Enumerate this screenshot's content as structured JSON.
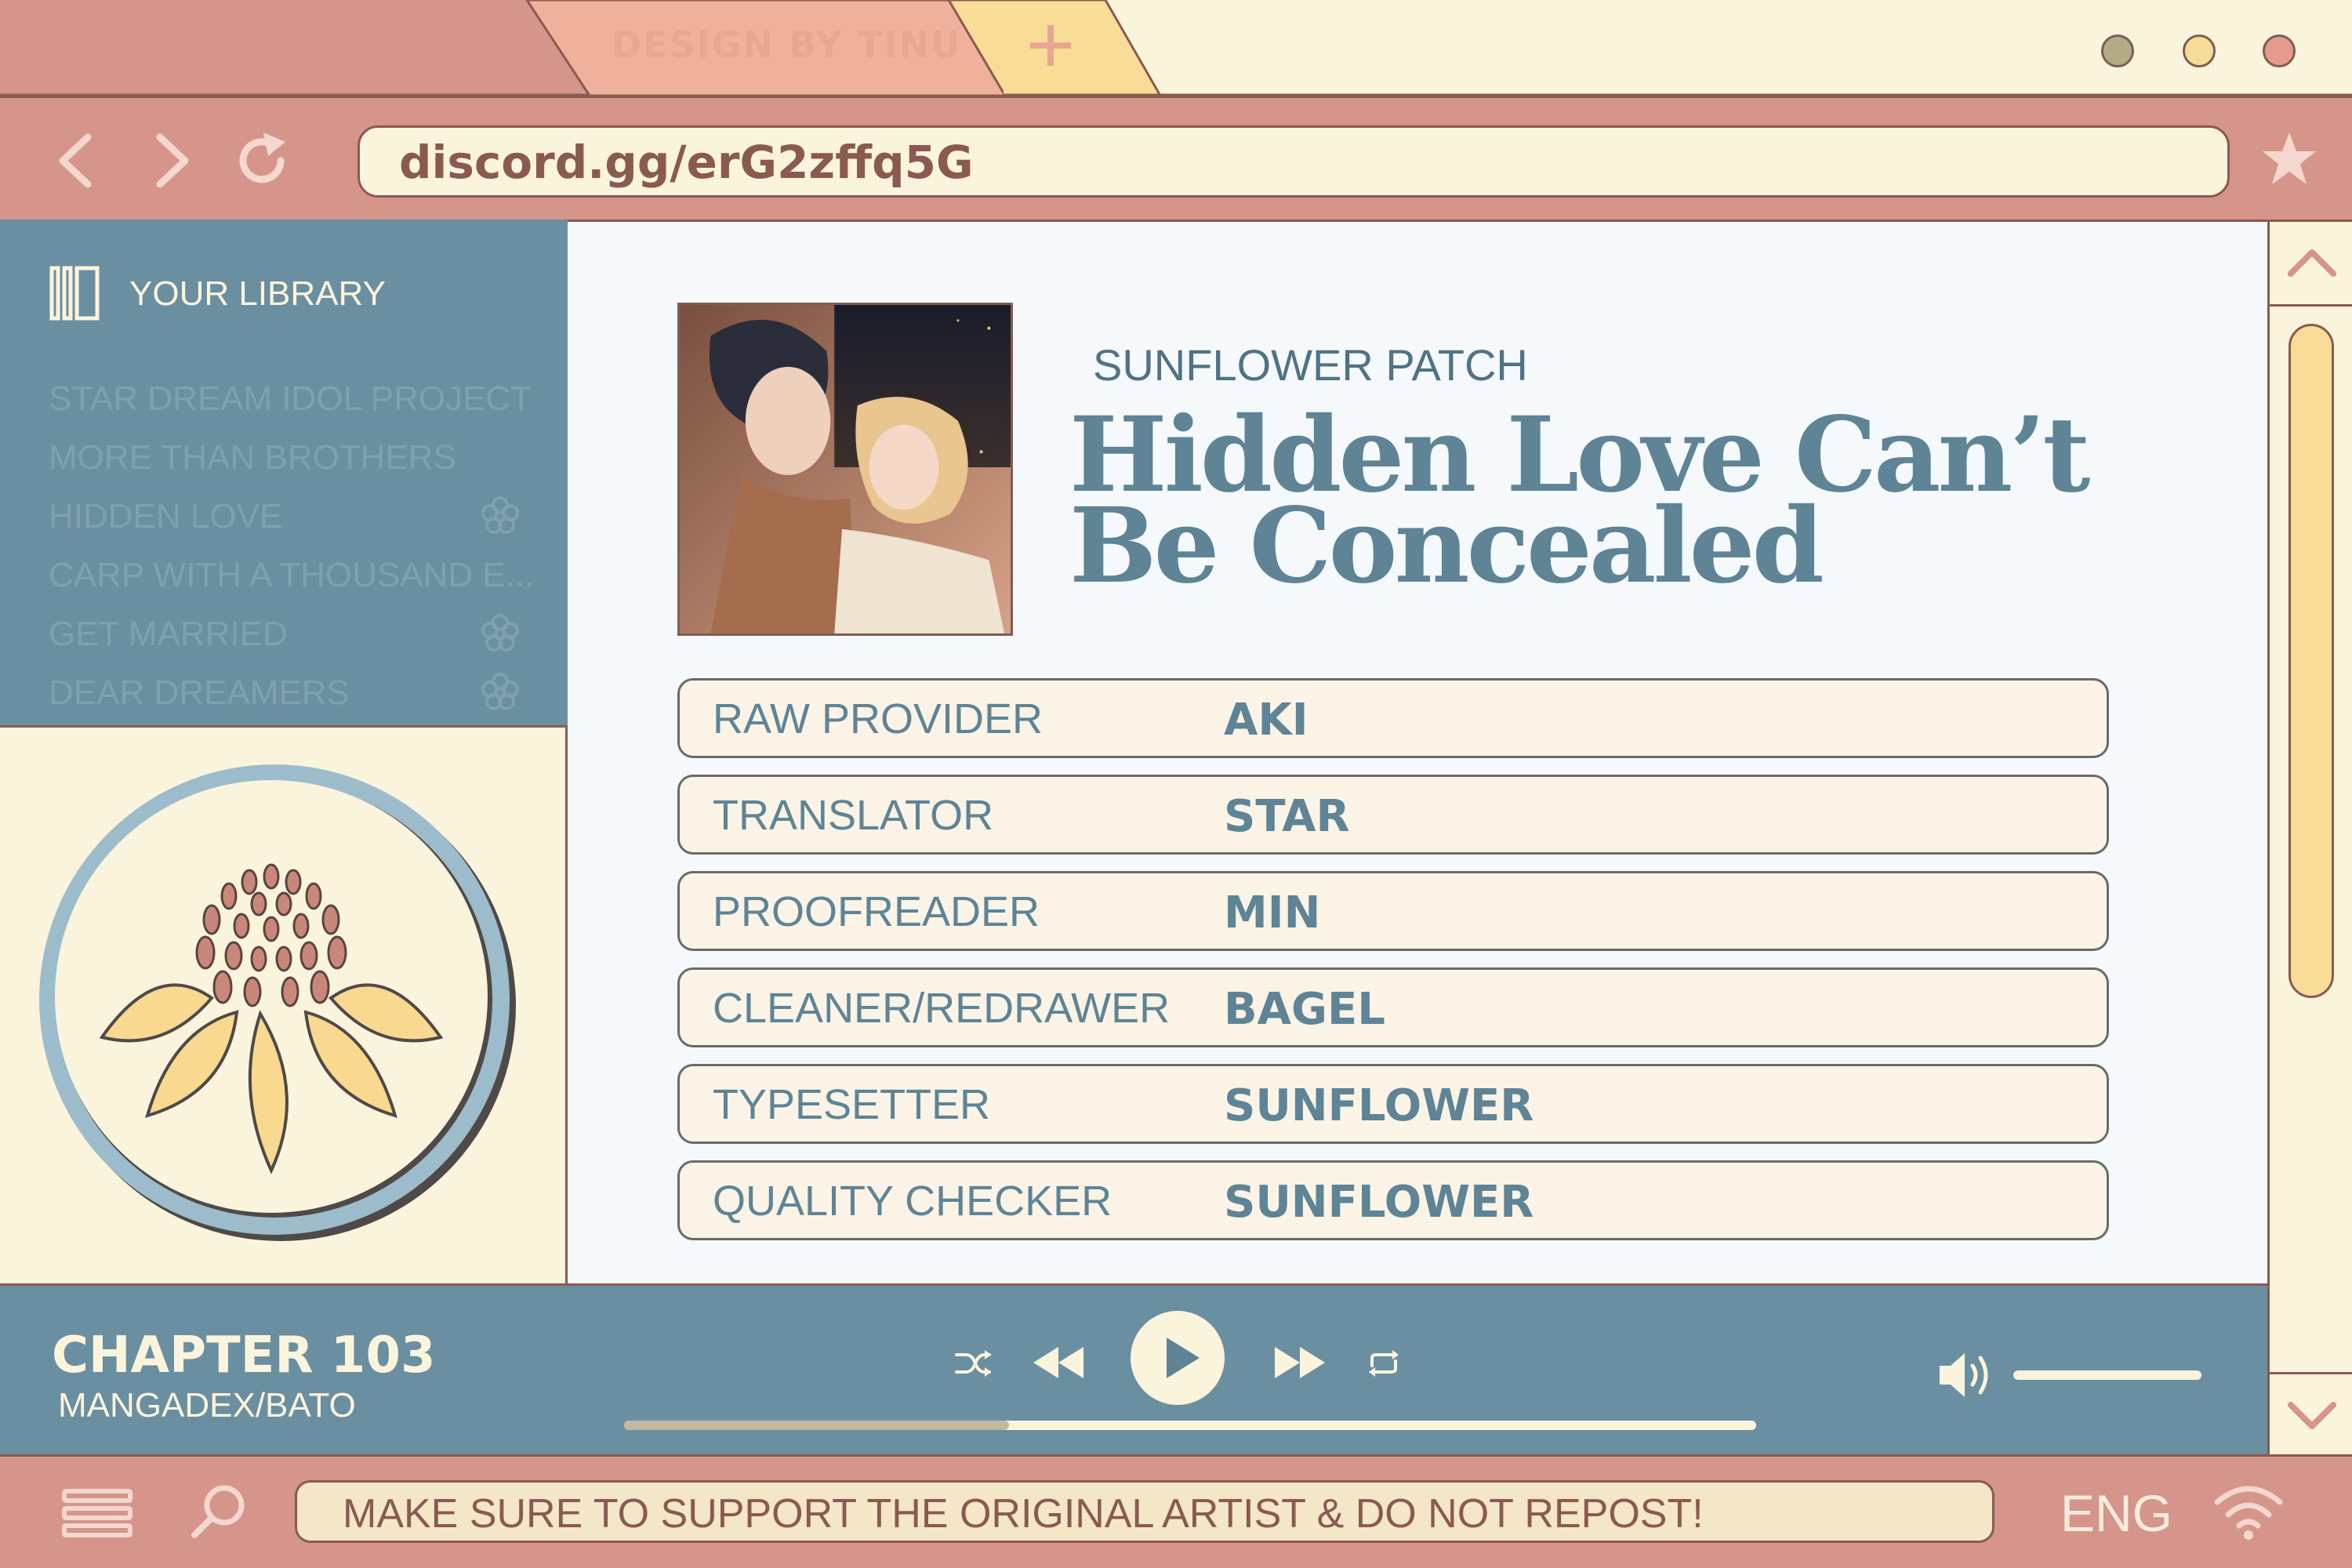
{
  "browser": {
    "tab_label": "DESIGN BY TINU",
    "url": "discord.gg/erG2zffq5G"
  },
  "sidebar": {
    "title": "YOUR LIBRARY",
    "items": [
      {
        "label": "STAR DREAM IDOL PROJECT"
      },
      {
        "label": "MORE THAN BROTHERS"
      },
      {
        "label": "HIDDEN LOVE"
      },
      {
        "label": "CARP WITH A THOUSAND E..."
      },
      {
        "label": "GET MARRIED"
      },
      {
        "label": "DEAR DREAMERS"
      }
    ]
  },
  "main": {
    "publisher": "SUNFLOWER PATCH",
    "title_line1": "Hidden Love Can’t",
    "title_line2": "Be Concealed",
    "credits": [
      {
        "role": "RAW PROVIDER",
        "name": "AKI"
      },
      {
        "role": "TRANSLATOR",
        "name": "STAR"
      },
      {
        "role": "PROOFREADER",
        "name": "MIN"
      },
      {
        "role": "CLEANER/REDRAWER",
        "name": "BAGEL"
      },
      {
        "role": "TYPESETTER",
        "name": "SUNFLOWER"
      },
      {
        "role": "QUALITY CHECKER",
        "name": "SUNFLOWER"
      }
    ]
  },
  "player": {
    "chapter": "CHAPTER 103",
    "source": "MANGADEX/BATO",
    "progress_fraction": 0.34,
    "volume_fraction": 1.0
  },
  "taskbar": {
    "notice": "MAKE SURE TO SUPPORT THE ORIGINAL ARTIST & DO NOT REPOST!",
    "language": "ENG"
  },
  "colors": {
    "rose": "#d5958a",
    "cream": "#fbf4dd",
    "slate_blue": "#6a8fa0",
    "title_blue": "#5e8496",
    "brown_outline": "#8a5a50",
    "sunflower_yellow": "#f8dc97"
  },
  "icons": {
    "back": "chevron-left-icon",
    "forward": "chevron-right-icon",
    "reload": "reload-icon",
    "bookmark": "star-icon",
    "library": "library-icon",
    "flower": "flower-icon",
    "shuffle": "shuffle-icon",
    "rewind": "rewind-icon",
    "play": "play-icon",
    "fast_forward": "fast-forward-icon",
    "repeat": "repeat-icon",
    "volume": "volume-icon",
    "menu": "hamburger-icon",
    "search": "search-icon",
    "wifi": "wifi-icon"
  }
}
